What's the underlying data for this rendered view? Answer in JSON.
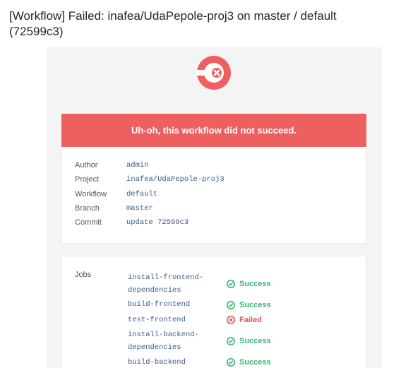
{
  "email": {
    "subject": "[Workflow] Failed: inafea/UdaPepole-proj3 on master / default (72599c3)"
  },
  "colors": {
    "failure_red": "#ee5f60",
    "success_green": "#3bb373",
    "failed_text": "#e05456",
    "link_blue": "#3a5a8a"
  },
  "banner": {
    "message": "Uh-oh, this workflow did not succeed."
  },
  "details": {
    "author_label": "Author",
    "author_value": "admin",
    "project_label": "Project",
    "project_value": "inafea/UdaPepole-proj3",
    "workflow_label": "Workflow",
    "workflow_value": "default",
    "branch_label": "Branch",
    "branch_value": "master",
    "commit_label": "Commit",
    "commit_value": "update 72599c3"
  },
  "jobs": {
    "label": "Jobs",
    "items": [
      {
        "name": "install-frontend-dependencies",
        "status": "Success",
        "icon": "success-icon"
      },
      {
        "name": "build-frontend",
        "status": "Success",
        "icon": "success-icon"
      },
      {
        "name": "test-frontend",
        "status": "Failed",
        "icon": "failed-icon"
      },
      {
        "name": "install-backend-dependencies",
        "status": "Success",
        "icon": "success-icon"
      },
      {
        "name": "build-backend",
        "status": "Success",
        "icon": "success-icon"
      }
    ]
  }
}
